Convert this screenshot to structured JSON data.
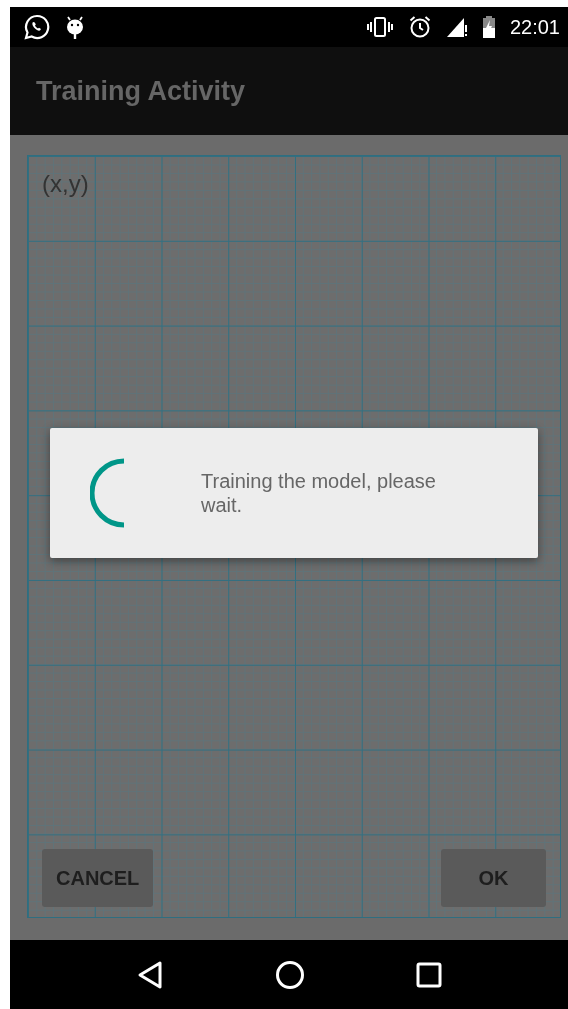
{
  "status_bar": {
    "time": "22:01"
  },
  "app_bar": {
    "title": "Training Activity"
  },
  "graph": {
    "label": "(x,y)"
  },
  "buttons": [
    {
      "label": "CANCEL"
    },
    {
      "label": "OK"
    }
  ],
  "dialog": {
    "message": "Training the model, please wait."
  }
}
